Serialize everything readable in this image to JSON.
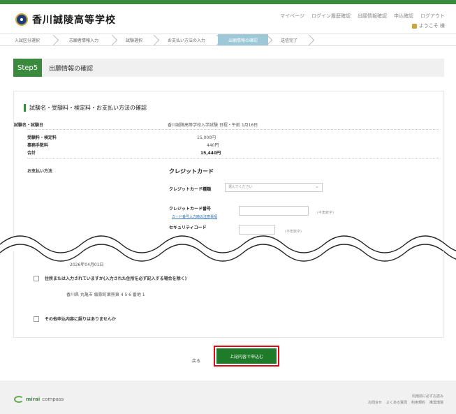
{
  "header": {
    "school_name": "香川誠陵高等学校",
    "nav": [
      "マイページ",
      "ログイン履歴確認",
      "出願情報確認",
      "申込確認",
      "ログアウト"
    ],
    "user": "ようこそ 様"
  },
  "steps": [
    "入試区分選択",
    "志願者情報入力",
    "試験選択",
    "お支払い方法の入力",
    "出願情報の確認",
    "送信完了"
  ],
  "active_step": 4,
  "step_bar": {
    "badge": "Step5",
    "title": "出願情報の確認"
  },
  "section": {
    "title": "試験名・受験料・検定料・お支払い方法の確認",
    "rows": [
      {
        "label": "試験名・試験日",
        "value": "香川誠陵高等学校入学試験 日程・午前 1月16日"
      },
      {
        "label": "受験料・検定料",
        "value": "15,000円"
      },
      {
        "label": "事務手数料",
        "value": "440円"
      },
      {
        "label": "合計",
        "value": "15,440円"
      }
    ],
    "payment_label": "お支払い方法",
    "payment_method": "クレジットカード",
    "card_type_label": "クレジットカード種類",
    "card_type_placeholder": "選んでください",
    "card_number_label": "クレジットカード番号",
    "card_number_link": "カード番号入力時の注意事項",
    "card_number_hint": "(半角数字)",
    "security_label": "セキュリティコード",
    "security_hint": "(半角数字)"
  },
  "confirmations": {
    "date_text": "2026年04月01日",
    "item1": "住所または入力されていますか(入力された住所を必ず記入する場合を除く)",
    "item1_sub": "香川県 丸亀市 綾歌町栗熊東 4 5 6 番地 1",
    "item2": "その他申込内容に誤りはありませんか"
  },
  "actions": {
    "back": "戻る",
    "next": "上記内容で申込む"
  },
  "footer": {
    "brand": "mirai",
    "brand2": "compass",
    "links_top": "利用前に必ずお読み",
    "links": [
      "お問合せ",
      "よくある質問",
      "利用規約",
      "推奨環境"
    ]
  }
}
